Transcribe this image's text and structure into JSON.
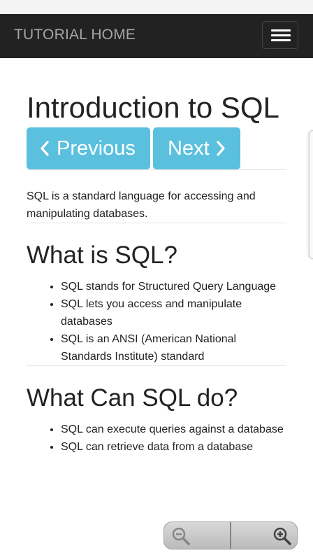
{
  "navbar": {
    "brand": "TUTORIAL HOME",
    "menu_icon": "hamburger-menu-icon",
    "background": "#222222"
  },
  "page": {
    "title": "Introduction to SQL",
    "pager": {
      "previous_label": "Previous",
      "next_label": "Next",
      "previous_icon": "chevron-left-icon",
      "next_icon": "chevron-right-icon",
      "button_color": "#5bc0de"
    },
    "intro": "SQL is a standard language for accessing and manipulating databases.",
    "sections": [
      {
        "heading": "What is SQL?",
        "items": [
          "SQL stands for Structured Query Language",
          "SQL lets you access and manipulate databases",
          "SQL is an ANSI (American National Standards Institute) standard"
        ]
      },
      {
        "heading": "What Can SQL do?",
        "items": [
          "SQL can execute queries against a database",
          "SQL can retrieve data from a database"
        ]
      }
    ]
  },
  "zoom_controls": {
    "zoom_out_icon": "zoom-out-icon",
    "zoom_in_icon": "zoom-in-icon"
  }
}
